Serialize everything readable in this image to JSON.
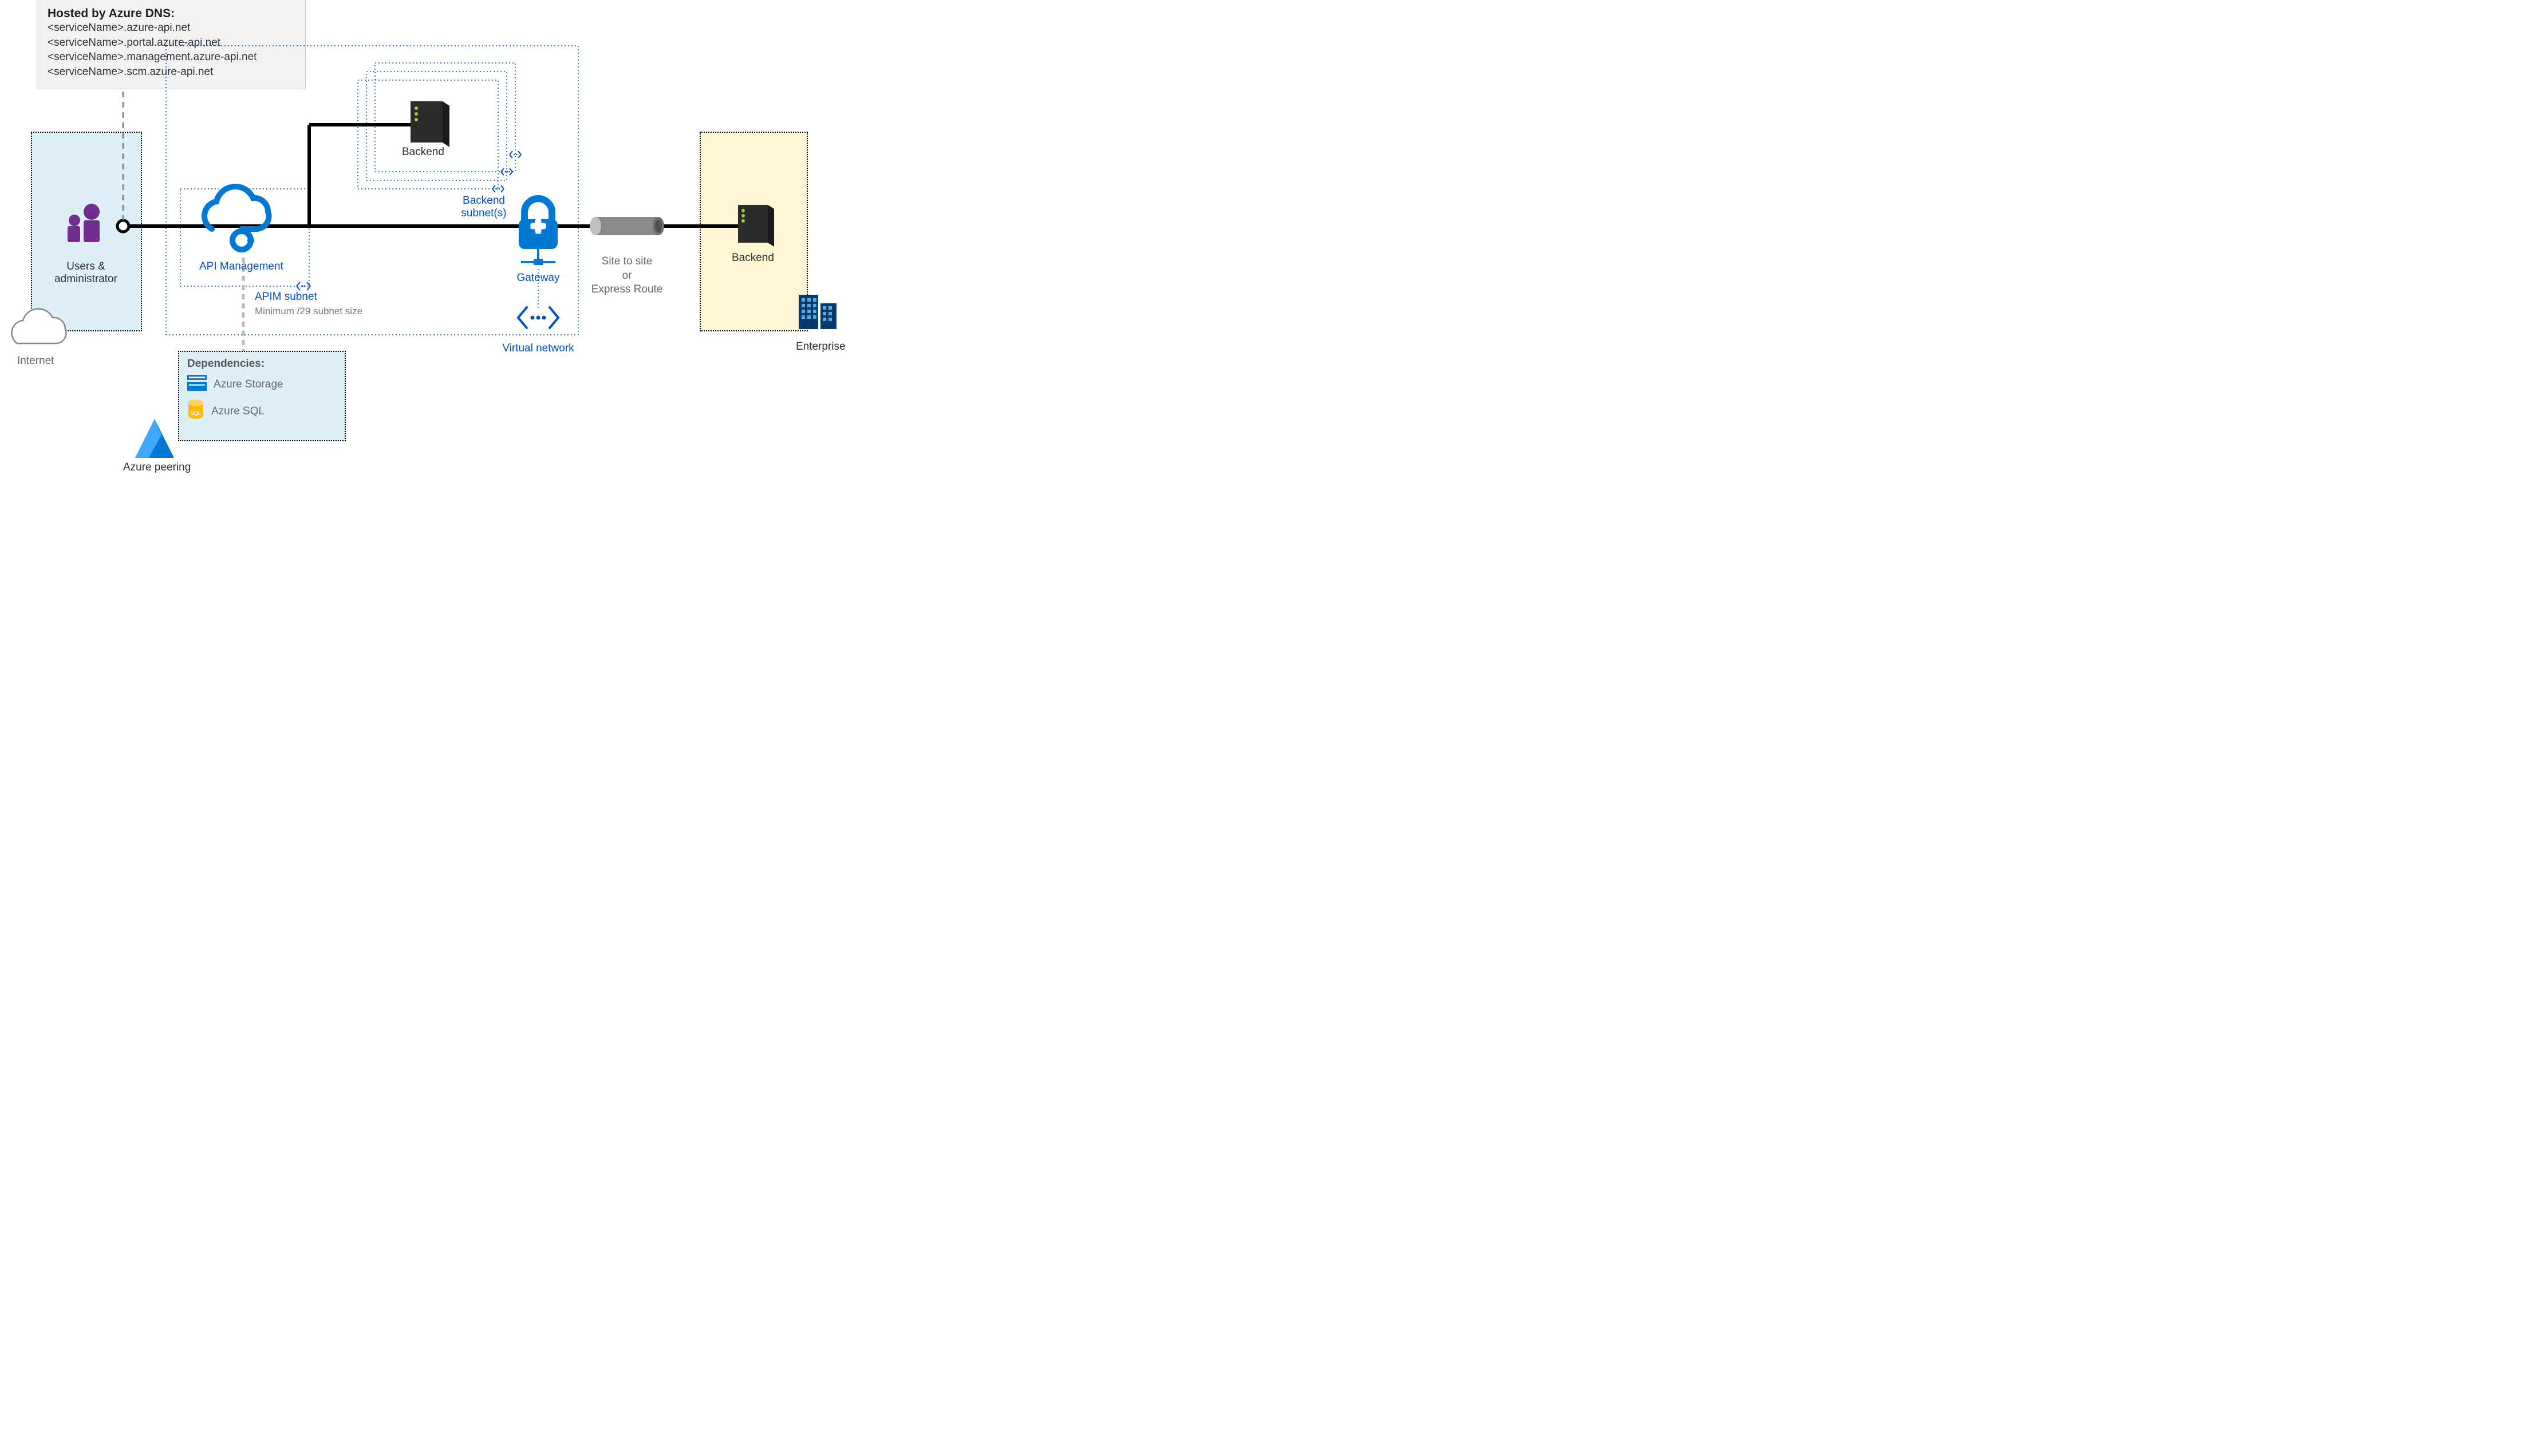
{
  "dnsBox": {
    "title": "Hosted by Azure DNS:",
    "lines": [
      "<serviceName>.azure-api.net",
      "<serviceName>.portal.azure-api.net",
      "<serviceName>.management.azure-api.net",
      "<serviceName>.scm.azure-api.net"
    ]
  },
  "internet": {
    "label": "Internet",
    "usersLabel": "Users &\nadministrator"
  },
  "apim": {
    "label": "API Management",
    "subnetLabel": "APIM subnet",
    "subnetNote": "Minimum /29 subnet size"
  },
  "backendCloud": {
    "label": "Backend"
  },
  "backendSubnets": {
    "label": "Backend\nsubnet(s)"
  },
  "gateway": {
    "label": "Gateway"
  },
  "vnet": {
    "label": "Virtual network"
  },
  "siteToSite": {
    "label": "Site to site\nor\nExpress Route"
  },
  "enterprise": {
    "backendLabel": "Backend",
    "label": "Enterprise"
  },
  "dependencies": {
    "title": "Dependencies:",
    "items": [
      "Azure Storage",
      "Azure SQL"
    ]
  },
  "azurePeering": {
    "label": "Azure peering"
  }
}
